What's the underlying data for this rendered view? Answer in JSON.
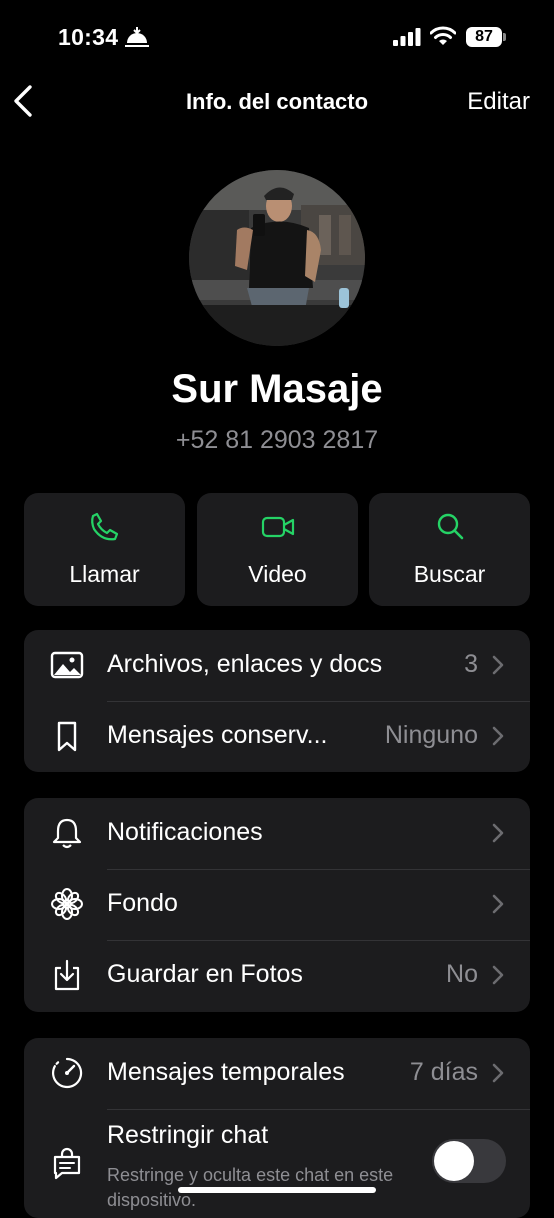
{
  "status": {
    "time": "10:34",
    "battery": "87"
  },
  "nav": {
    "title": "Info. del contacto",
    "edit": "Editar"
  },
  "contact": {
    "name": "Sur Masaje",
    "phone": "+52 81 2903 2817"
  },
  "actions": [
    {
      "label": "Llamar",
      "icon": "phone-icon"
    },
    {
      "label": "Video",
      "icon": "video-icon"
    },
    {
      "label": "Buscar",
      "icon": "search-icon"
    }
  ],
  "media_card": {
    "files": {
      "label": "Archivos, enlaces y docs",
      "value": "3"
    },
    "kept": {
      "label": "Mensajes conserv...",
      "value": "Ninguno"
    }
  },
  "settings_card": {
    "notifications": {
      "label": "Notificaciones"
    },
    "wallpaper": {
      "label": "Fondo"
    },
    "save_photos": {
      "label": "Guardar en Fotos",
      "value": "No"
    }
  },
  "privacy_card": {
    "disappearing": {
      "label": "Mensajes temporales",
      "value": "7 días"
    },
    "restrict": {
      "label": "Restringir chat",
      "subtitle": "Restringe y oculta este chat en este dispositivo.",
      "enabled": false
    }
  },
  "colors": {
    "accent": "#25d366",
    "card": "#1c1c1e",
    "secondary_text": "#8e8e93"
  }
}
